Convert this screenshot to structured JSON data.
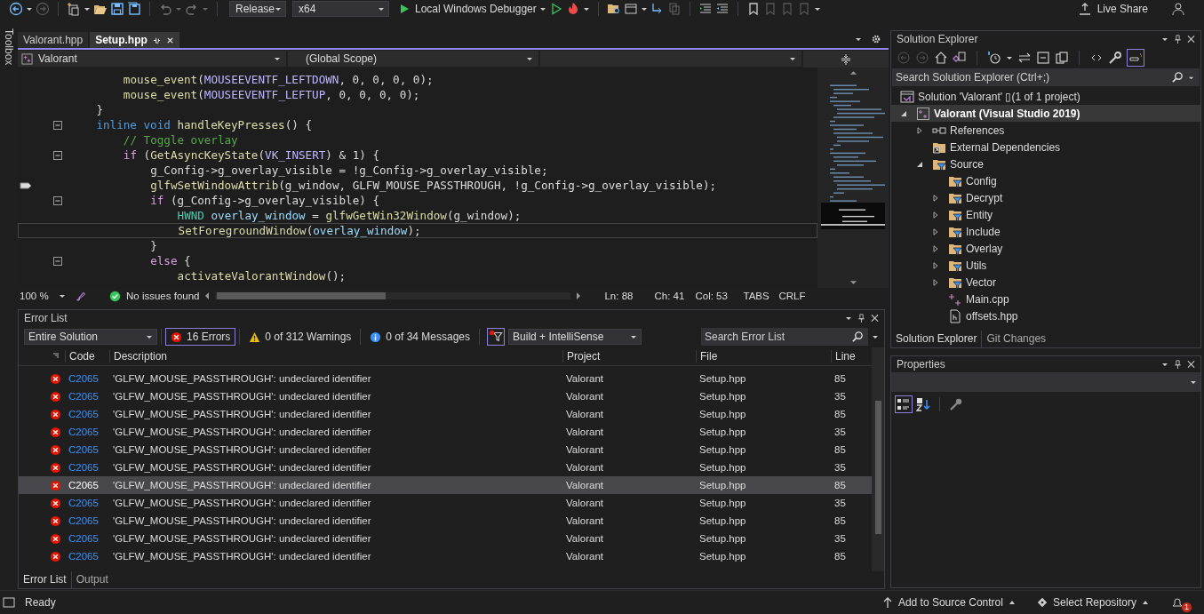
{
  "toolbar": {
    "configuration": "Release",
    "platform": "x64",
    "debugger": "Local Windows Debugger",
    "live_share": "Live Share"
  },
  "toolbox_label": "Toolbox",
  "editor": {
    "tabs": [
      {
        "label": "Valorant.hpp",
        "selected": false
      },
      {
        "label": "Setup.hpp",
        "selected": true
      }
    ],
    "nav": {
      "project": "Valorant",
      "scope": "(Global Scope)"
    },
    "lines": [
      {
        "children": [
          {
            "fold": false,
            "bookmark": false,
            "current": false,
            "tokens": [
              {
                "kind": "func",
                "t": "mouse_event"
              },
              {
                "kind": "plain",
                "t": "("
              },
              {
                "kind": "macro",
                "t": "MOUSEEVENTF_LEFTDOWN"
              },
              {
                "kind": "plain",
                "t": ", 0, 0, 0, 0);"
              }
            ]
          },
          {
            "fold": false,
            "bookmark": false,
            "current": false,
            "tokens": [
              {
                "kind": "func",
                "t": "mouse_event"
              },
              {
                "kind": "plain",
                "t": "("
              },
              {
                "kind": "macro",
                "t": "MOUSEEVENTF_LEFTUP"
              },
              {
                "kind": "plain",
                "t": ", 0, 0, 0, 0);"
              }
            ]
          }
        ]
      },
      {
        "fold": false,
        "bookmark": false,
        "current": false,
        "tokens": [
          {
            "kind": "plain",
            "t": "}"
          }
        ]
      },
      {
        "fold": true,
        "bookmark": false,
        "current": false,
        "tokens": [
          {
            "kind": "kw",
            "t": "inline void"
          },
          {
            "kind": "func",
            "t": " handleKeyPresses"
          },
          {
            "kind": "plain",
            "t": "() {"
          }
        ],
        "children": [
          {
            "fold": false,
            "bookmark": false,
            "current": false,
            "tokens": [
              {
                "kind": "comment",
                "t": "// Toggle overlay"
              }
            ]
          },
          {
            "fold": true,
            "bookmark": false,
            "current": false,
            "tokens": [
              {
                "kind": "ctrl",
                "t": "if"
              },
              {
                "kind": "plain",
                "t": " ("
              },
              {
                "kind": "func",
                "t": "GetAsyncKeyState"
              },
              {
                "kind": "plain",
                "t": "("
              },
              {
                "kind": "macro",
                "t": "VK_INSERT"
              },
              {
                "kind": "plain",
                "t": ") & 1) {"
              }
            ],
            "children": [
              {
                "fold": false,
                "bookmark": false,
                "current": false,
                "tokens": [
                  {
                    "kind": "plain",
                    "t": "g_Config->g_overlay_visible = !g_Config->g_overlay_visible;"
                  }
                ]
              },
              {
                "fold": false,
                "bookmark": true,
                "current": false,
                "tokens": [
                  {
                    "kind": "func",
                    "t": "glfwSetWindowAttrib"
                  },
                  {
                    "kind": "plain",
                    "t": "(g_window, GLFW_MOUSE_PASSTHROUGH, !g_Config->g_overlay_visible);"
                  }
                ]
              },
              {
                "fold": true,
                "bookmark": false,
                "current": false,
                "tokens": [
                  {
                    "kind": "ctrl",
                    "t": "if"
                  },
                  {
                    "kind": "plain",
                    "t": " (g_Config->g_overlay_visible) {"
                  }
                ],
                "children": [
                  {
                    "fold": false,
                    "bookmark": false,
                    "current": false,
                    "tokens": [
                      {
                        "kind": "type",
                        "t": "HWND"
                      },
                      {
                        "kind": "var",
                        "t": " overlay_window"
                      },
                      {
                        "kind": "plain",
                        "t": " = "
                      },
                      {
                        "kind": "func",
                        "t": "glfwGetWin32Window"
                      },
                      {
                        "kind": "plain",
                        "t": "(g_window);"
                      }
                    ]
                  },
                  {
                    "fold": false,
                    "bookmark": false,
                    "current": true,
                    "tokens": [
                      {
                        "kind": "func",
                        "t": "SetForegroundWindow"
                      },
                      {
                        "kind": "plain",
                        "t": "("
                      },
                      {
                        "kind": "var",
                        "t": "overlay_window"
                      },
                      {
                        "kind": "plain",
                        "t": ");"
                      }
                    ]
                  }
                ]
              },
              {
                "fold": false,
                "bookmark": false,
                "current": false,
                "tokens": [
                  {
                    "kind": "plain",
                    "t": "}"
                  }
                ]
              },
              {
                "fold": true,
                "bookmark": false,
                "current": false,
                "tokens": [
                  {
                    "kind": "ctrl",
                    "t": "else"
                  },
                  {
                    "kind": "plain",
                    "t": " {"
                  }
                ],
                "children": [
                  {
                    "fold": false,
                    "bookmark": false,
                    "current": false,
                    "tokens": [
                      {
                        "kind": "func",
                        "t": "activateValorantWindow"
                      },
                      {
                        "kind": "plain",
                        "t": "();"
                      }
                    ]
                  }
                ]
              }
            ]
          }
        ]
      }
    ],
    "status": {
      "zoom": "100 %",
      "issues": "No issues found",
      "ln": "Ln: 88",
      "ch": "Ch: 41",
      "col": "Col: 53",
      "tabs": "TABS",
      "eol": "CRLF"
    }
  },
  "error_list": {
    "title": "Error List",
    "scope": "Entire Solution",
    "filters": [
      {
        "kind": "error",
        "label": "16 Errors",
        "selected": true
      },
      {
        "kind": "warning",
        "label": "0 of 312 Warnings",
        "selected": false
      },
      {
        "kind": "message",
        "label": "0 of 34 Messages",
        "selected": false
      }
    ],
    "source": "Build + IntelliSense",
    "search_placeholder": "Search Error List",
    "columns": [
      "Code",
      "Description",
      "Project",
      "File",
      "Line"
    ],
    "rows": [
      {
        "code": "C2065",
        "description": "'GLFW_MOUSE_PASSTHROUGH': undeclared identifier",
        "project": "Valorant",
        "file": "Setup.hpp",
        "line": "85",
        "selected": false
      },
      {
        "code": "C2065",
        "description": "'GLFW_MOUSE_PASSTHROUGH': undeclared identifier",
        "project": "Valorant",
        "file": "Setup.hpp",
        "line": "35",
        "selected": false
      },
      {
        "code": "C2065",
        "description": "'GLFW_MOUSE_PASSTHROUGH': undeclared identifier",
        "project": "Valorant",
        "file": "Setup.hpp",
        "line": "85",
        "selected": false
      },
      {
        "code": "C2065",
        "description": "'GLFW_MOUSE_PASSTHROUGH': undeclared identifier",
        "project": "Valorant",
        "file": "Setup.hpp",
        "line": "35",
        "selected": false
      },
      {
        "code": "C2065",
        "description": "'GLFW_MOUSE_PASSTHROUGH': undeclared identifier",
        "project": "Valorant",
        "file": "Setup.hpp",
        "line": "85",
        "selected": false
      },
      {
        "code": "C2065",
        "description": "'GLFW_MOUSE_PASSTHROUGH': undeclared identifier",
        "project": "Valorant",
        "file": "Setup.hpp",
        "line": "35",
        "selected": false
      },
      {
        "code": "C2065",
        "description": "'GLFW_MOUSE_PASSTHROUGH': undeclared identifier",
        "project": "Valorant",
        "file": "Setup.hpp",
        "line": "85",
        "selected": true
      },
      {
        "code": "C2065",
        "description": "'GLFW_MOUSE_PASSTHROUGH': undeclared identifier",
        "project": "Valorant",
        "file": "Setup.hpp",
        "line": "35",
        "selected": false
      },
      {
        "code": "C2065",
        "description": "'GLFW_MOUSE_PASSTHROUGH': undeclared identifier",
        "project": "Valorant",
        "file": "Setup.hpp",
        "line": "85",
        "selected": false
      },
      {
        "code": "C2065",
        "description": "'GLFW_MOUSE_PASSTHROUGH': undeclared identifier",
        "project": "Valorant",
        "file": "Setup.hpp",
        "line": "35",
        "selected": false
      },
      {
        "code": "C2065",
        "description": "'GLFW_MOUSE_PASSTHROUGH': undeclared identifier",
        "project": "Valorant",
        "file": "Setup.hpp",
        "line": "85",
        "selected": false
      }
    ],
    "tabs": [
      {
        "label": "Error List",
        "selected": true
      },
      {
        "label": "Output",
        "selected": false
      }
    ]
  },
  "solution_explorer": {
    "title": "Solution Explorer",
    "search_placeholder": "Search Solution Explorer (Ctrl+;)",
    "tree": [
      {
        "kind": "solution",
        "label": "Solution 'Valorant' ▯(1 of 1 project)",
        "selected": false,
        "children": [
          {
            "kind": "project",
            "label": "Valorant (Visual Studio 2019)",
            "selected": true,
            "expanded": true,
            "children": [
              {
                "kind": "references",
                "label": "References",
                "selected": false,
                "expanded": false
              },
              {
                "kind": "external",
                "label": "External Dependencies",
                "selected": false
              },
              {
                "kind": "filter",
                "label": "Source",
                "selected": false,
                "expanded": true,
                "children": [
                  {
                    "kind": "filter",
                    "label": "Config",
                    "selected": false
                  },
                  {
                    "kind": "filter",
                    "label": "Decrypt",
                    "selected": false,
                    "expanded": false
                  },
                  {
                    "kind": "filter",
                    "label": "Entity",
                    "selected": false,
                    "expanded": false
                  },
                  {
                    "kind": "filter",
                    "label": "Include",
                    "selected": false,
                    "expanded": false
                  },
                  {
                    "kind": "filter",
                    "label": "Overlay",
                    "selected": false,
                    "expanded": false
                  },
                  {
                    "kind": "filter",
                    "label": "Utils",
                    "selected": false,
                    "expanded": false
                  },
                  {
                    "kind": "filter",
                    "label": "Vector",
                    "selected": false,
                    "expanded": false
                  },
                  {
                    "kind": "cpp",
                    "label": "Main.cpp",
                    "selected": false
                  },
                  {
                    "kind": "header",
                    "label": "offsets.hpp",
                    "selected": false
                  }
                ]
              }
            ]
          }
        ]
      }
    ],
    "tabs": [
      {
        "label": "Solution Explorer",
        "selected": true
      },
      {
        "label": "Git Changes",
        "selected": false
      }
    ]
  },
  "properties": {
    "title": "Properties"
  },
  "status_bar": {
    "status": "Ready",
    "source_control": "Add to Source Control",
    "repository": "Select Repository",
    "notifications": "1"
  }
}
